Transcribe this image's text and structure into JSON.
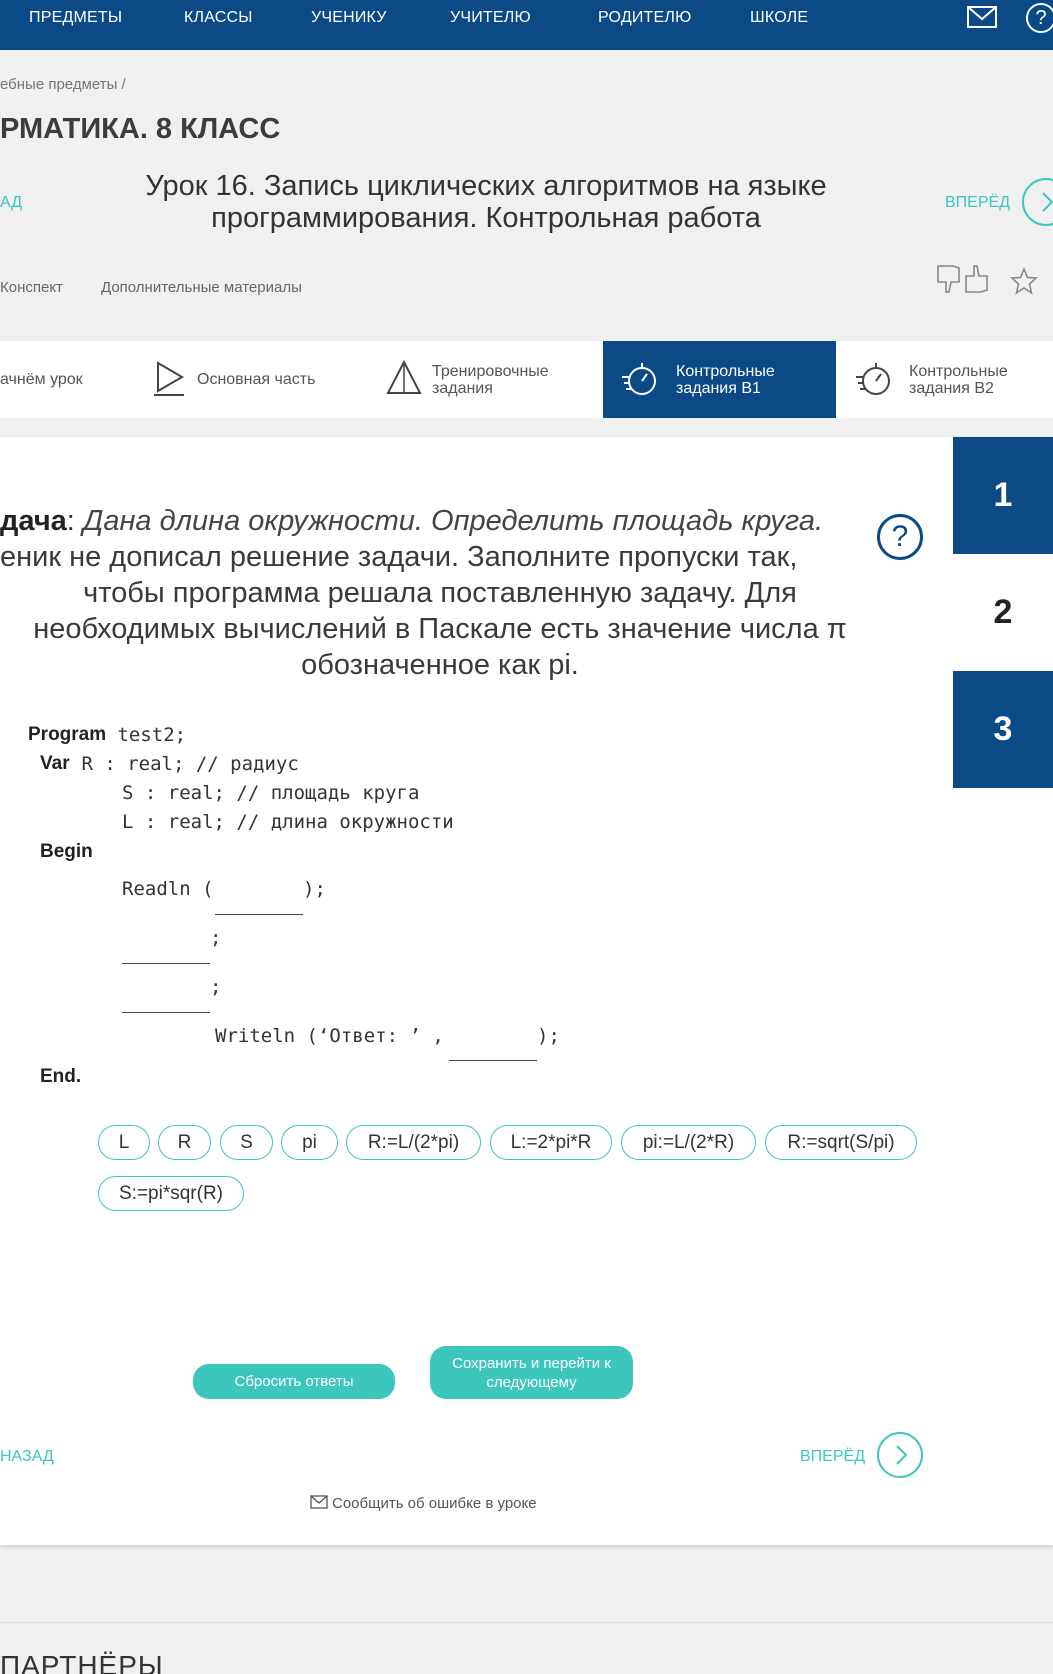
{
  "topnav": {
    "items": [
      "ПРЕДМЕТЫ",
      "КЛАССЫ",
      "УЧЕНИКУ",
      "УЧИТЕЛЮ",
      "РОДИТЕЛЮ",
      "ШКОЛЕ"
    ],
    "help_glyph": "?"
  },
  "header": {
    "breadcrumb": "ебные предметы  /",
    "subject": "РМАТИКА. 8 КЛАСС",
    "lesson_title": "Урок 16. Запись циклических алгоритмов на языке программирования. Контрольная работа",
    "back_label": "АД",
    "forward_label": "ВПЕРЁД",
    "links": [
      "Конспект",
      "Дополнительные материалы"
    ]
  },
  "tabs": [
    {
      "label": "ачнём урок",
      "icon": "start-icon"
    },
    {
      "label": "Основная часть",
      "icon": "play-icon"
    },
    {
      "label": "Тренировочные\nзадания",
      "icon": "pyramid-icon"
    },
    {
      "label": "Контрольные\nзадания В1",
      "icon": "stopwatch-icon",
      "active": true
    },
    {
      "label": "Контрольные\nзадания В2",
      "icon": "stopwatch-icon"
    }
  ],
  "task": {
    "label": "дача",
    "colon": ": ",
    "italic": "Дана длина окружности. Определить площадь круга.",
    "line2": "еник не дописал решение задачи. Заполните пропуски так,",
    "line3": "чтобы программа решала поставленную задачу. Для",
    "line4": "необходимых вычислений в Паскале есть значение числа π",
    "line5": "обозначенное как pi.",
    "help_glyph": "?"
  },
  "question_nav": [
    "1",
    "2",
    "3"
  ],
  "code": {
    "kw_program": "Program",
    "program_rest": " test2;",
    "kw_var": "Var",
    "var_rest": " R : real; // радиус",
    "line_s": "S : real; // площадь круга",
    "line_l": "L : real; // длина окружности",
    "kw_begin": "Begin",
    "readln_open": "Readln (",
    "readln_close": ");",
    "semi1": ";",
    "semi2": ";",
    "writeln_open": "Writeln (‘Ответ: ’ ,",
    "writeln_close": ");",
    "kw_end": "End."
  },
  "chips": [
    "L",
    "R",
    "S",
    "pi",
    "R:=L/(2*pi)",
    "L:=2*pi*R",
    "pi:=L/(2*R)",
    "R:=sqrt(S/pi)",
    "S:=pi*sqr(R)"
  ],
  "buttons": {
    "reset": "Сбросить ответы",
    "save": "Сохранить и перейти к следующему"
  },
  "bottom_nav": {
    "back": "НАЗАД",
    "forward": "ВПЕРЁД"
  },
  "report": "Сообщить об ошибке в уроке",
  "footer": {
    "partners": "ПАРТНЁРЫ"
  },
  "colors": {
    "brand_blue": "#0b4a86",
    "accent_teal": "#3cc6bd"
  }
}
